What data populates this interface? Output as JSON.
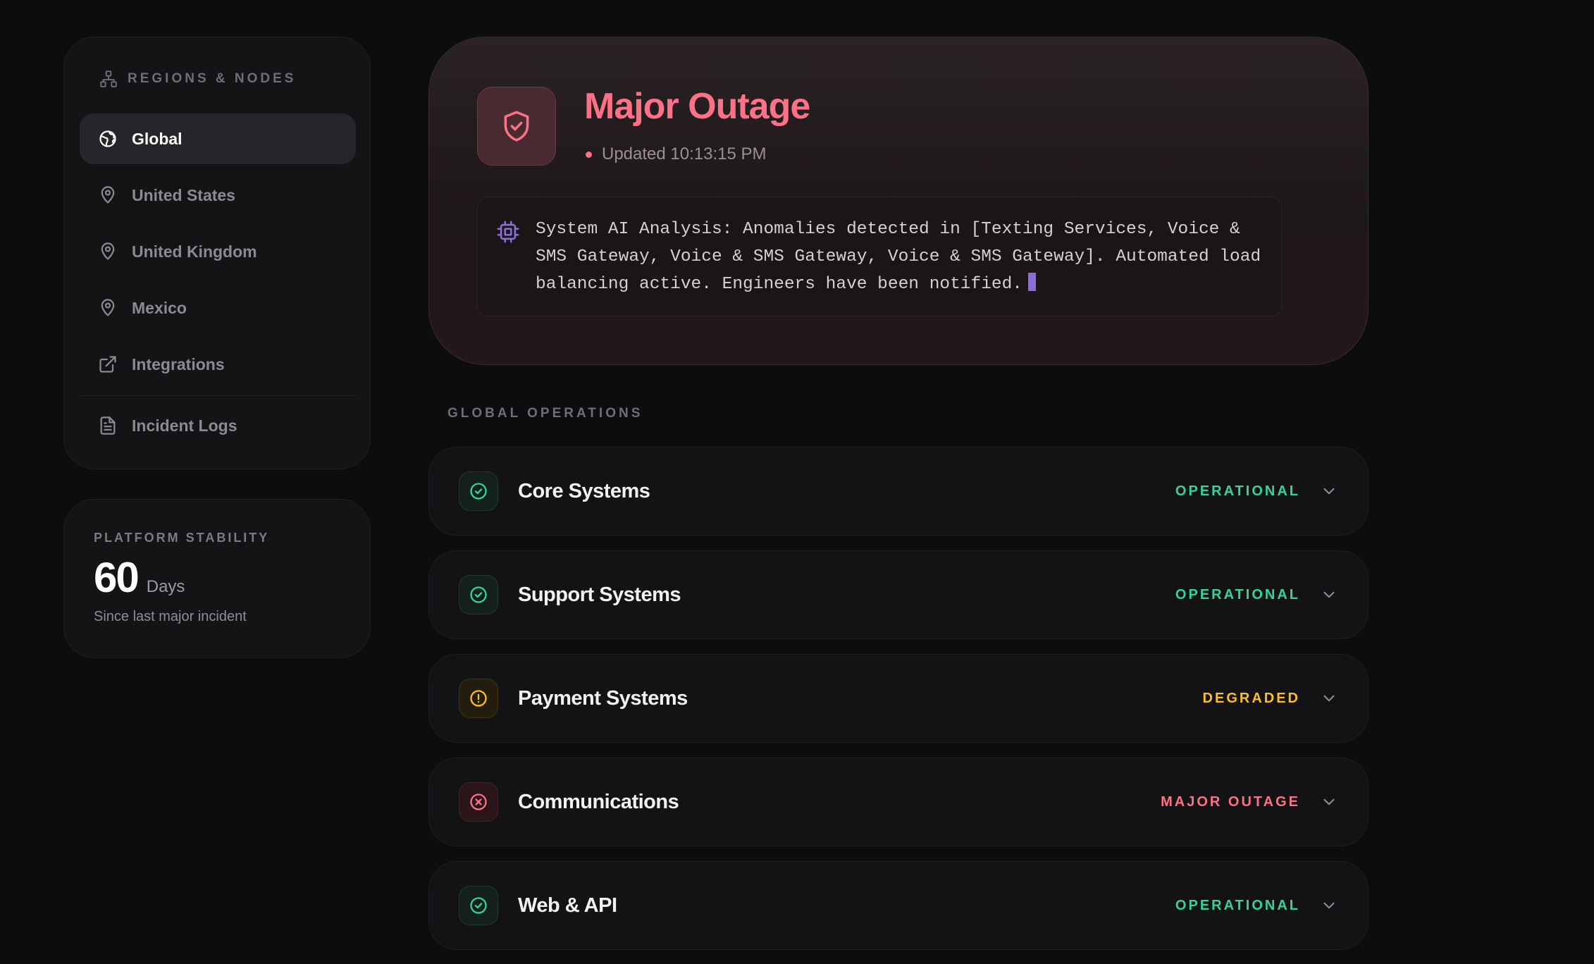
{
  "sidebar": {
    "heading": "REGIONS & NODES",
    "items": [
      {
        "label": "Global"
      },
      {
        "label": "United States"
      },
      {
        "label": "United Kingdom"
      },
      {
        "label": "Mexico"
      },
      {
        "label": "Integrations"
      },
      {
        "label": "Incident Logs"
      }
    ]
  },
  "stability": {
    "title": "PLATFORM STABILITY",
    "value": "60",
    "unit": "Days",
    "subtitle": "Since last major incident"
  },
  "hero": {
    "title": "Major Outage",
    "updated": "Updated 10:13:15 PM",
    "analysis": "System AI Analysis: Anomalies detected in [Texting Services, Voice & SMS Gateway, Voice & SMS Gateway, Voice & SMS Gateway]. Automated load balancing active. Engineers have been notified."
  },
  "operations": {
    "label": "GLOBAL OPERATIONS",
    "rows": [
      {
        "name": "Core Systems",
        "status": "OPERATIONAL"
      },
      {
        "name": "Support Systems",
        "status": "OPERATIONAL"
      },
      {
        "name": "Payment Systems",
        "status": "DEGRADED"
      },
      {
        "name": "Communications",
        "status": "MAJOR OUTAGE"
      },
      {
        "name": "Web & API",
        "status": "OPERATIONAL"
      }
    ]
  },
  "colors": {
    "operational": "#34d399",
    "degraded": "#fbbf24",
    "outage": "#fb7185",
    "ai_accent": "#8b6fd6"
  }
}
